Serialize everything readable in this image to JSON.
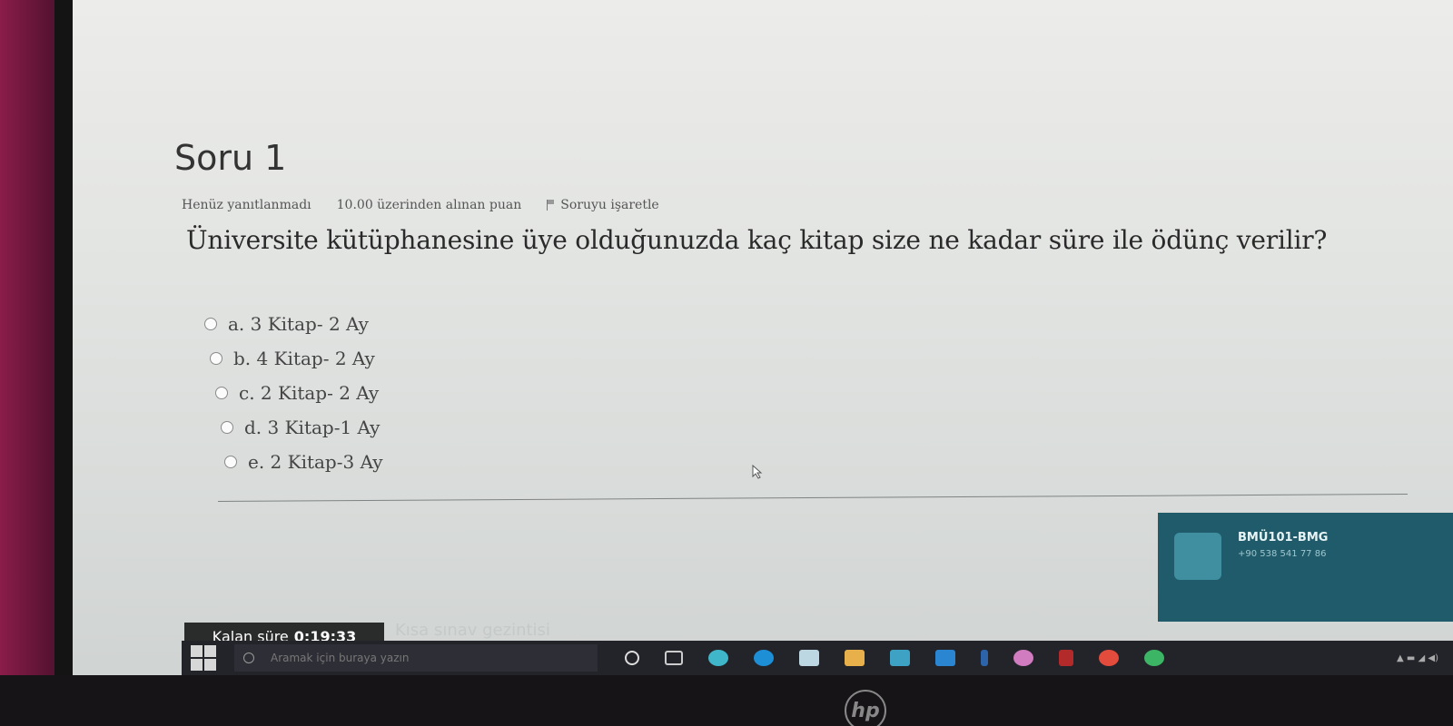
{
  "question": {
    "title": "Soru 1",
    "status": "Henüz yanıtlanmadı",
    "points": "10.00 üzerinden alınan puan",
    "flag_label": "Soruyu işaretle",
    "text": "Üniversite kütüphanesine üye olduğunuzda kaç kitap size ne kadar süre ile ödünç verilir?",
    "options": [
      {
        "label": "a. 3 Kitap- 2 Ay"
      },
      {
        "label": "b. 4 Kitap- 2 Ay"
      },
      {
        "label": "c. 2 Kitap- 2 Ay"
      },
      {
        "label": "d. 3 Kitap-1 Ay"
      },
      {
        "label": "e. 2 Kitap-3 Ay"
      }
    ]
  },
  "timer": {
    "label": "Kalan süre",
    "value": "0:19:33"
  },
  "nav_link": "Kısa sınav gezintisi",
  "notification": {
    "name": "BMÜ101-BMG",
    "phone": "+90 538 541 77 86",
    "line1": "",
    "line2": ""
  },
  "taskbar": {
    "search_placeholder": "Aramak için buraya yazın"
  },
  "brand": {
    "logo": "hp"
  }
}
